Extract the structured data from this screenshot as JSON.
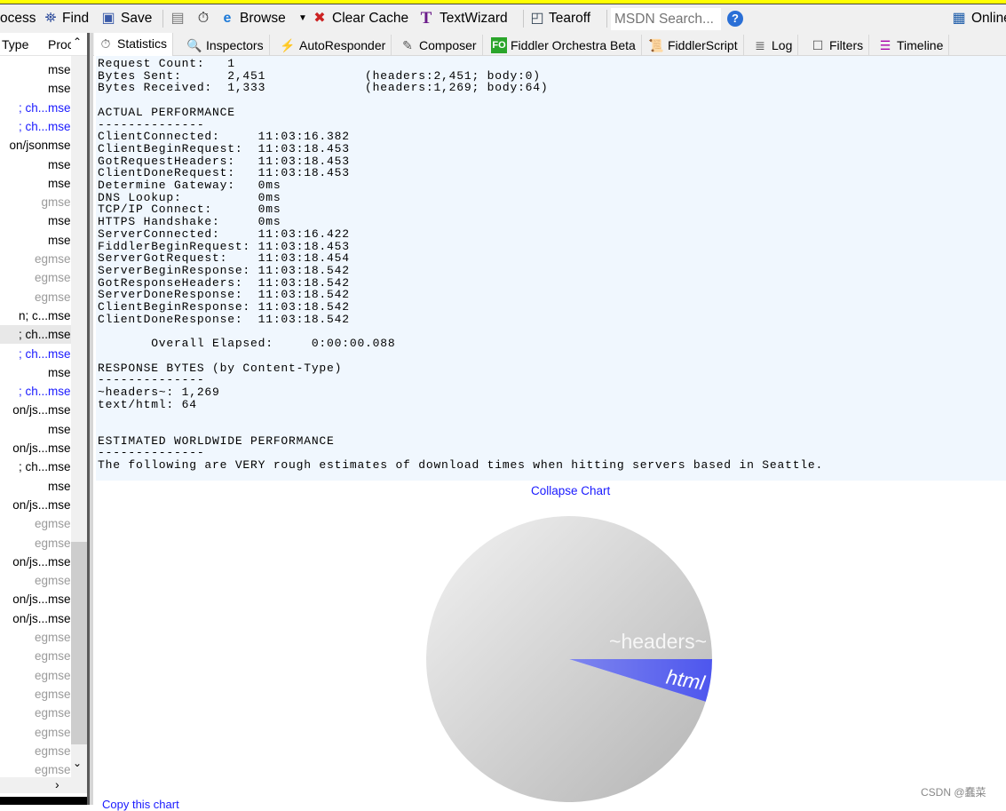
{
  "toolbar": {
    "process_label": "ocess",
    "find_label": "Find",
    "save_label": "Save",
    "browse_label": "Browse",
    "clear_cache_label": "Clear Cache",
    "textwizard_label": "TextWizard",
    "tearoff_label": "Tearoff",
    "msdn_placeholder": "MSDN Search...",
    "online_label": "Online"
  },
  "session_list": {
    "headers": [
      "Type",
      "Proc"
    ],
    "rows": [
      {
        "type": "",
        "proc": "mse",
        "color": "black"
      },
      {
        "type": "",
        "proc": "mse",
        "color": "black"
      },
      {
        "type": "; ch...",
        "proc": "mse",
        "color": "blue"
      },
      {
        "type": "; ch...",
        "proc": "mse",
        "color": "blue"
      },
      {
        "type": "on/json",
        "proc": "mse",
        "color": "black"
      },
      {
        "type": "",
        "proc": "mse",
        "color": "black"
      },
      {
        "type": "",
        "proc": "mse",
        "color": "black"
      },
      {
        "type": "g",
        "proc": "mse",
        "color": "gray"
      },
      {
        "type": "",
        "proc": "mse",
        "color": "black"
      },
      {
        "type": "",
        "proc": "mse",
        "color": "black"
      },
      {
        "type": "eg",
        "proc": "mse",
        "color": "gray"
      },
      {
        "type": "eg",
        "proc": "mse",
        "color": "gray"
      },
      {
        "type": "eg",
        "proc": "mse",
        "color": "gray"
      },
      {
        "type": "n; c...",
        "proc": "mse",
        "color": "black"
      },
      {
        "type": "; ch...",
        "proc": "mse",
        "color": "black",
        "selected": true
      },
      {
        "type": "; ch...",
        "proc": "mse",
        "color": "blue"
      },
      {
        "type": "",
        "proc": "mse",
        "color": "black"
      },
      {
        "type": "; ch...",
        "proc": "mse",
        "color": "blue"
      },
      {
        "type": "on/js...",
        "proc": "mse",
        "color": "black"
      },
      {
        "type": "",
        "proc": "mse",
        "color": "black"
      },
      {
        "type": "on/js...",
        "proc": "mse",
        "color": "black"
      },
      {
        "type": "; ch...",
        "proc": "mse",
        "color": "black"
      },
      {
        "type": "",
        "proc": "mse",
        "color": "black"
      },
      {
        "type": "on/js...",
        "proc": "mse",
        "color": "black"
      },
      {
        "type": "eg",
        "proc": "mse",
        "color": "gray"
      },
      {
        "type": "eg",
        "proc": "mse",
        "color": "gray"
      },
      {
        "type": "on/js...",
        "proc": "mse",
        "color": "black"
      },
      {
        "type": "eg",
        "proc": "mse",
        "color": "gray"
      },
      {
        "type": "on/js...",
        "proc": "mse",
        "color": "black"
      },
      {
        "type": "on/js...",
        "proc": "mse",
        "color": "black"
      },
      {
        "type": "eg",
        "proc": "mse",
        "color": "gray"
      },
      {
        "type": "eg",
        "proc": "mse",
        "color": "gray"
      },
      {
        "type": "eg",
        "proc": "mse",
        "color": "gray"
      },
      {
        "type": "eg",
        "proc": "mse",
        "color": "gray"
      },
      {
        "type": "eg",
        "proc": "mse",
        "color": "gray"
      },
      {
        "type": "eg",
        "proc": "mse",
        "color": "gray"
      },
      {
        "type": "eg",
        "proc": "mse",
        "color": "gray"
      },
      {
        "type": "eg",
        "proc": "mse",
        "color": "gray"
      }
    ]
  },
  "tabs": [
    {
      "label": "Statistics",
      "icon": "stopwatch-icon",
      "selected": true
    },
    {
      "label": "Inspectors",
      "icon": "magnifier-icon"
    },
    {
      "label": "AutoResponder",
      "icon": "lightning-icon"
    },
    {
      "label": "Composer",
      "icon": "compose-icon"
    },
    {
      "label": "Fiddler Orchestra Beta",
      "icon": "fo-icon"
    },
    {
      "label": "FiddlerScript",
      "icon": "script-icon"
    },
    {
      "label": "Log",
      "icon": "log-icon"
    },
    {
      "label": "Filters",
      "icon": "checkbox-icon"
    },
    {
      "label": "Timeline",
      "icon": "timeline-icon"
    }
  ],
  "statistics": {
    "lines": [
      "Request Count:   1",
      "Bytes Sent:      2,451             (headers:2,451; body:0)",
      "Bytes Received:  1,333             (headers:1,269; body:64)",
      "",
      "ACTUAL PERFORMANCE",
      "--------------",
      "ClientConnected:     11:03:16.382",
      "ClientBeginRequest:  11:03:18.453",
      "GotRequestHeaders:   11:03:18.453",
      "ClientDoneRequest:   11:03:18.453",
      "Determine Gateway:   0ms",
      "DNS Lookup:          0ms",
      "TCP/IP Connect:      0ms",
      "HTTPS Handshake:     0ms",
      "ServerConnected:     11:03:16.422",
      "FiddlerBeginRequest: 11:03:18.453",
      "ServerGotRequest:    11:03:18.454",
      "ServerBeginResponse: 11:03:18.542",
      "GotResponseHeaders:  11:03:18.542",
      "ServerDoneResponse:  11:03:18.542",
      "ClientBeginResponse: 11:03:18.542",
      "ClientDoneResponse:  11:03:18.542",
      "",
      "       Overall Elapsed:     0:00:00.088",
      "",
      "RESPONSE BYTES (by Content-Type)",
      "--------------",
      "~headers~: 1,269",
      "text/html: 64",
      "",
      "",
      "ESTIMATED WORLDWIDE PERFORMANCE",
      "--------------",
      "The following are VERY rough estimates of download times when hitting servers based in Seattle."
    ]
  },
  "chart": {
    "collapse_label": "Collapse Chart",
    "copy_label": "Copy this chart"
  },
  "chart_data": {
    "type": "pie",
    "categories": [
      "~headers~",
      "html"
    ],
    "values": [
      1269,
      64
    ],
    "colors": [
      "#d4d4d4",
      "#5b63ee"
    ]
  },
  "watermark": "CSDN @蠢菜"
}
